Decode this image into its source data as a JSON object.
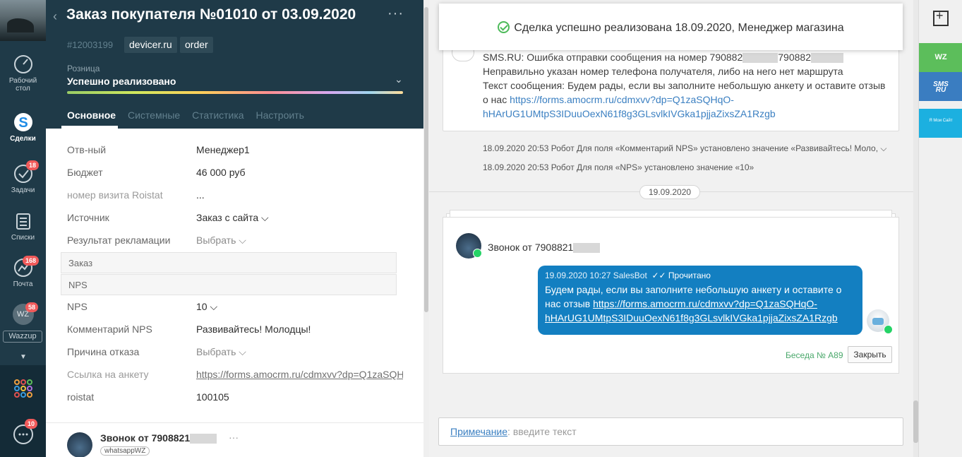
{
  "nav": {
    "items": [
      {
        "label_line1": "Рабочий",
        "label_line2": "стол"
      },
      {
        "label": "Сделки"
      },
      {
        "label": "Задачи",
        "badge": "18"
      },
      {
        "label": "Списки"
      },
      {
        "label": "Почта",
        "badge": "168"
      },
      {
        "label": "WZ",
        "badge": "58"
      }
    ],
    "wazzup_label": "Wazzup",
    "chat_badge": "10"
  },
  "card": {
    "title": "Заказ покупателя №01010 от 03.09.2020",
    "lead_id": "#12003199",
    "tags": [
      "devicer.ru",
      "order"
    ],
    "pipeline": "Розница",
    "status": "Успешно реализовано",
    "tabs": [
      "Основное",
      "Системные",
      "Статистика",
      "Настроить"
    ],
    "fields": [
      {
        "label": "Отв-ный",
        "value": "Менеджер1"
      },
      {
        "label": "Бюджет",
        "value": "46 000 руб"
      },
      {
        "label": "номер визита Roistat",
        "value": "..."
      },
      {
        "label": "Источник",
        "value": "Заказ с сайта ⌵"
      },
      {
        "label": "Результат рекламации",
        "value": "Выбрать ⌵"
      }
    ],
    "sections": [
      "Заказ",
      "NPS"
    ],
    "fields2": [
      {
        "label": "NPS",
        "value": "10 ⌵"
      },
      {
        "label": "Комментарий NPS",
        "value": "Развивайтесь! Молодцы!"
      },
      {
        "label": "Причина отказа",
        "value": "Выбрать ⌵"
      },
      {
        "label": "Ссылка на анкету",
        "value": "https://forms.amocrm.ru/cdmxvv?dp=Q1zaSQH"
      },
      {
        "label": "roistat",
        "value": "100105"
      }
    ],
    "call_title": "Звонок от 7908821",
    "call_chip": "whatsappWZ"
  },
  "feed": {
    "toast": "Сделка успешно реализована 18.09.2020, Менеджер магазина",
    "sms": {
      "line1": "SMS.RU: Ошибка отправки сообщения на номер 790882",
      "line1b": "790882",
      "line2": "Неправильно указан номер телефона получателя, либо на него нет маршрута",
      "line3": "Текст сообщения: Будем рады, если вы заполните небольшую анкету и оставите отзыв",
      "line4": "о нас",
      "link": "https://forms.amocrm.ru/cdmxvv?dp=Q1zaSQHqO-",
      "link2": "hHArUG1UMtpS3IDuuOexN61f8g3GLsvlkIVGka1pjjaZixsZA1Rzgb"
    },
    "log1": "18.09.2020 20:53 Робот  Для поля «Комментарий NPS» установлено значение «Развивайтесь! Моло, ⌵",
    "log2": "18.09.2020 20:53 Робот  Для поля «NPS» установлено значение «10»",
    "date": "19.09.2020",
    "call": {
      "title": "Звонок от 7908821",
      "meta": "19.09.2020 10:27 SalesBot",
      "read": "✓✓ Прочитано",
      "text": "Будем рады, если вы заполните небольшую анкету и оставите о нас отзыв",
      "link1": "https://forms.amocrm.ru/cdmxvv?dp=Q1zaSQHqO-",
      "link2": "hHArUG1UMtpS3IDuuOexN61f8g3GLsvlkIVGka1pjjaZixsZA1Rzgb",
      "conversation": "Беседа № A89",
      "close": "Закрыть"
    },
    "note_label": "Примечание",
    "note_placeholder": ": введите текст"
  },
  "widgets": {
    "wz": "WZ",
    "sms1": "SMS",
    "sms2": "RU",
    "blue": "Я\nМои\nСайт"
  }
}
